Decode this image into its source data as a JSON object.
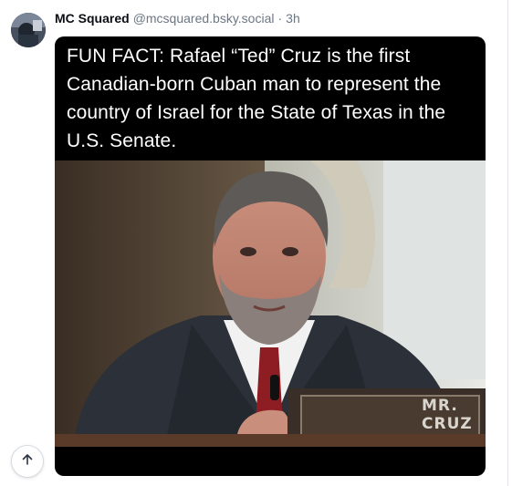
{
  "post": {
    "author_name": "MC Squared",
    "author_handle": "@mcsquared.bsky.social",
    "separator": "·",
    "time": "3h"
  },
  "media": {
    "meme_text": "FUN FACT: Rafael “Ted” Cruz is the first Canadian-born Cuban man to represent the country of Israel for the State of Texas in the U.S. Senate.",
    "nameplate_text": "MR. CRUZ"
  },
  "controls": {
    "scroll_top_icon": "arrow-up-icon"
  }
}
